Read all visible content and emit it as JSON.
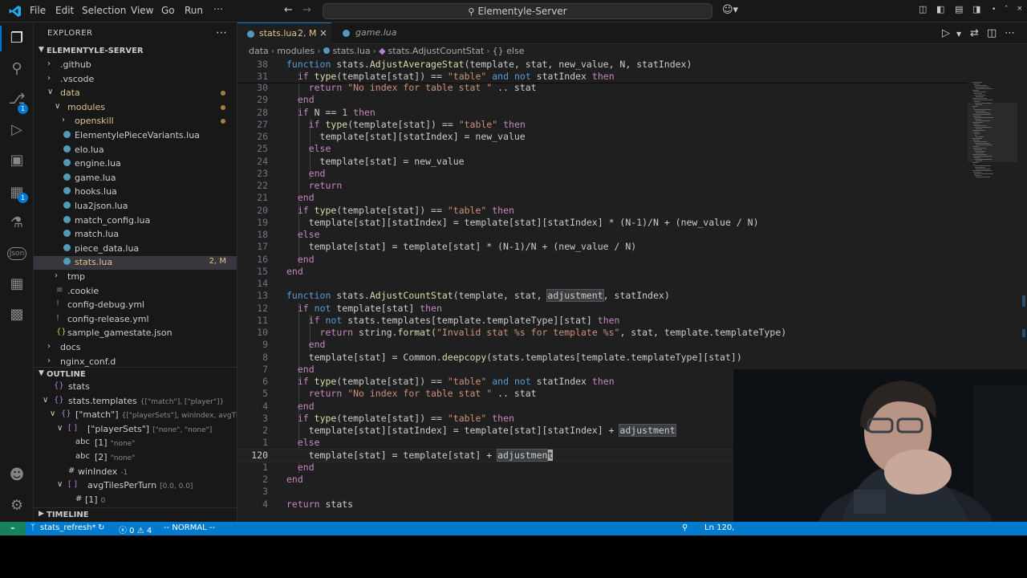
{
  "titlebar": {
    "menus": [
      "File",
      "Edit",
      "Selection",
      "View",
      "Go",
      "Run"
    ],
    "more": "⋯",
    "search_text": "Elementyle-Server"
  },
  "activitybar": {
    "scm_badge": "1",
    "extensions_badge": "1",
    "json_label": "Json"
  },
  "explorer": {
    "title": "EXPLORER",
    "root": "ELEMENTYLE-SERVER",
    "items": [
      {
        "label": ".github",
        "kind": "folder",
        "expanded": false,
        "depth": 1
      },
      {
        "label": ".vscode",
        "kind": "folder",
        "expanded": false,
        "depth": 1
      },
      {
        "label": "data",
        "kind": "folder",
        "expanded": true,
        "depth": 1,
        "modified": true
      },
      {
        "label": "modules",
        "kind": "folder",
        "expanded": true,
        "depth": 2,
        "modified": true
      },
      {
        "label": "openskill",
        "kind": "folder",
        "expanded": false,
        "depth": 3,
        "modified": true
      },
      {
        "label": "ElementylePieceVariants.lua",
        "kind": "lua",
        "depth": 3
      },
      {
        "label": "elo.lua",
        "kind": "lua",
        "depth": 3
      },
      {
        "label": "engine.lua",
        "kind": "lua",
        "depth": 3
      },
      {
        "label": "game.lua",
        "kind": "lua",
        "depth": 3
      },
      {
        "label": "hooks.lua",
        "kind": "lua",
        "depth": 3
      },
      {
        "label": "lua2json.lua",
        "kind": "lua",
        "depth": 3
      },
      {
        "label": "match_config.lua",
        "kind": "lua",
        "depth": 3
      },
      {
        "label": "match.lua",
        "kind": "lua",
        "depth": 3
      },
      {
        "label": "piece_data.lua",
        "kind": "lua",
        "depth": 3
      },
      {
        "label": "stats.lua",
        "kind": "lua",
        "depth": 3,
        "selected": true,
        "status": "2, M"
      },
      {
        "label": "tmp",
        "kind": "folder",
        "expanded": false,
        "depth": 2
      },
      {
        "label": ".cookie",
        "kind": "file",
        "depth": 2
      },
      {
        "label": "config-debug.yml",
        "kind": "yml",
        "depth": 2
      },
      {
        "label": "config-release.yml",
        "kind": "yml",
        "depth": 2
      },
      {
        "label": "sample_gamestate.json",
        "kind": "json",
        "depth": 2
      },
      {
        "label": "docs",
        "kind": "folder",
        "expanded": false,
        "depth": 1
      },
      {
        "label": "nginx_conf.d",
        "kind": "folder",
        "expanded": false,
        "depth": 1
      }
    ]
  },
  "outline": {
    "title": "OUTLINE",
    "items": [
      {
        "label": "stats",
        "detail": "",
        "icon": "{}",
        "depth": 1,
        "chev": ""
      },
      {
        "label": "stats.templates",
        "detail": "{[\"match\"], [\"player\"]}",
        "icon": "{}",
        "depth": 1,
        "chev": "v"
      },
      {
        "label": "[\"match\"]",
        "detail": "{[\"playerSets\"], winIndex, avgTi...",
        "icon": "{}",
        "depth": 2,
        "chev": "v"
      },
      {
        "label": "[\"playerSets\"]",
        "detail": "[\"none\", \"none\"]",
        "icon": "[ ]",
        "depth": 3,
        "chev": "v"
      },
      {
        "label": "[1]",
        "detail": "\"none\"",
        "icon": "abc",
        "depth": 4,
        "chev": ""
      },
      {
        "label": "[2]",
        "detail": "\"none\"",
        "icon": "abc",
        "depth": 4,
        "chev": ""
      },
      {
        "label": "winIndex",
        "detail": "-1",
        "icon": "#",
        "depth": 3,
        "chev": ""
      },
      {
        "label": "avgTilesPerTurn",
        "detail": "[0.0, 0.0]",
        "icon": "[ ]",
        "depth": 3,
        "chev": "v"
      },
      {
        "label": "[1]",
        "detail": "0",
        "icon": "#",
        "depth": 4,
        "chev": ""
      }
    ],
    "timeline_title": "TIMELINE"
  },
  "tabs": [
    {
      "label": "stats.lua",
      "status": "2, M",
      "active": true
    },
    {
      "label": "game.lua",
      "status": "",
      "active": false
    }
  ],
  "breadcrumbs": [
    "data",
    "modules",
    "stats.lua",
    "stats.AdjustCountStat",
    "{} else"
  ],
  "code": {
    "sticky": [
      {
        "num": "38",
        "text": "function stats.AdjustAverageStat(template, stat, new_value, N, statIndex)"
      },
      {
        "num": "31",
        "text": "  if type(template[stat]) == \"table\" and not statIndex then"
      }
    ],
    "lines": [
      {
        "num": "30",
        "text": "    return \"No index for table stat \" .. stat"
      },
      {
        "num": "29",
        "text": "  end"
      },
      {
        "num": "28",
        "text": "  if N == 1 then"
      },
      {
        "num": "27",
        "text": "    if type(template[stat]) == \"table\" then"
      },
      {
        "num": "26",
        "text": "      template[stat][statIndex] = new_value"
      },
      {
        "num": "25",
        "text": "    else"
      },
      {
        "num": "24",
        "text": "      template[stat] = new_value"
      },
      {
        "num": "23",
        "text": "    end"
      },
      {
        "num": "22",
        "text": "    return"
      },
      {
        "num": "21",
        "text": "  end"
      },
      {
        "num": "20",
        "text": "  if type(template[stat]) == \"table\" then"
      },
      {
        "num": "19",
        "text": "    template[stat][statIndex] = template[stat][statIndex] * (N-1)/N + (new_value / N)"
      },
      {
        "num": "18",
        "text": "  else"
      },
      {
        "num": "17",
        "text": "    template[stat] = template[stat] * (N-1)/N + (new_value / N)"
      },
      {
        "num": "16",
        "text": "  end"
      },
      {
        "num": "15",
        "text": "end"
      },
      {
        "num": "14",
        "text": ""
      },
      {
        "num": "13",
        "text": "function stats.AdjustCountStat(template, stat, adjustment, statIndex)"
      },
      {
        "num": "12",
        "text": "  if not template[stat] then"
      },
      {
        "num": "11",
        "text": "    if not stats.templates[template.templateType][stat] then"
      },
      {
        "num": "10",
        "text": "      return string.format(\"Invalid stat %s for template %s\", stat, template.templateType)"
      },
      {
        "num": "9",
        "text": "    end"
      },
      {
        "num": "8",
        "text": "    template[stat] = Common.deepcopy(stats.templates[template.templateType][stat])"
      },
      {
        "num": "7",
        "text": "  end"
      },
      {
        "num": "6",
        "text": "  if type(template[stat]) == \"table\" and not statIndex then"
      },
      {
        "num": "5",
        "text": "    return \"No index for table stat \" .. stat"
      },
      {
        "num": "4",
        "text": "  end"
      },
      {
        "num": "3",
        "text": "  if type(template[stat]) == \"table\" then"
      },
      {
        "num": "2",
        "text": "    template[stat][statIndex] = template[stat][statIndex] + adjustment"
      },
      {
        "num": "1",
        "text": "  else"
      },
      {
        "num": "120",
        "text": "    template[stat] = template[stat] + adjustment",
        "current": true
      },
      {
        "num": "1",
        "text": "  end"
      },
      {
        "num": "2",
        "text": "end"
      },
      {
        "num": "3",
        "text": ""
      },
      {
        "num": "4",
        "text": "return stats"
      }
    ]
  },
  "statusbar": {
    "remote": "⌁",
    "branch": "stats_refresh*",
    "sync": "↻",
    "errors": "ⓧ 0 ⚠ 4",
    "mode": "-- NORMAL --",
    "position": "Ln 120,"
  }
}
